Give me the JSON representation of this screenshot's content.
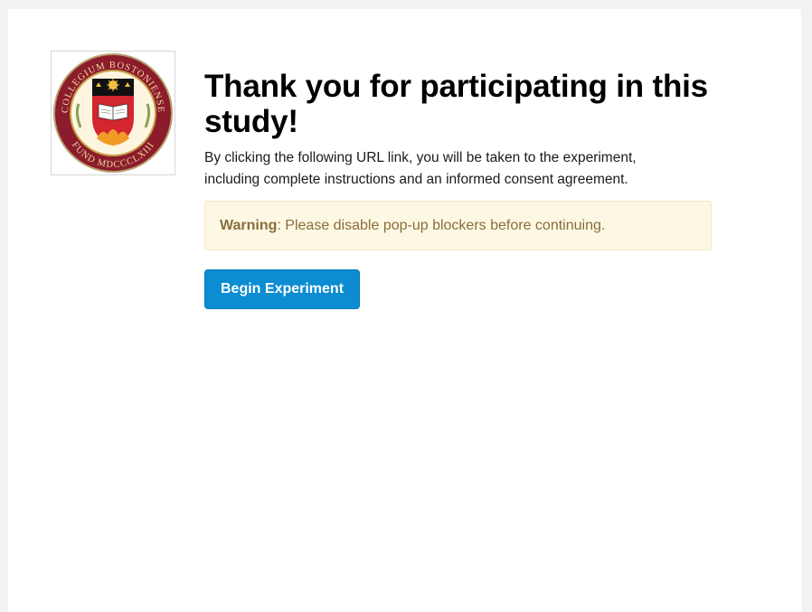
{
  "page": {
    "title": "Thank you for participating in this study!",
    "intro": "By clicking the following URL link, you will be taken to the experiment, including complete instructions and an informed consent agreement.",
    "warning": {
      "label": "Warning",
      "text": ": Please disable pop-up blockers before continuing."
    },
    "begin_button": "Begin Experiment"
  },
  "logo": {
    "icon": "university-seal-icon",
    "ring_top_text": "COLLEGIUM BOSTONIENSE",
    "ring_bottom_text": "FUND MDCCCLXIII",
    "colors": {
      "maroon": "#8b1c2b",
      "gold": "#c9a14a",
      "red": "#d4262f",
      "black": "#111111"
    }
  },
  "colors": {
    "button_bg": "#0b8cd3",
    "alert_bg": "#fcf8e3",
    "alert_text": "#8a6d3b"
  }
}
